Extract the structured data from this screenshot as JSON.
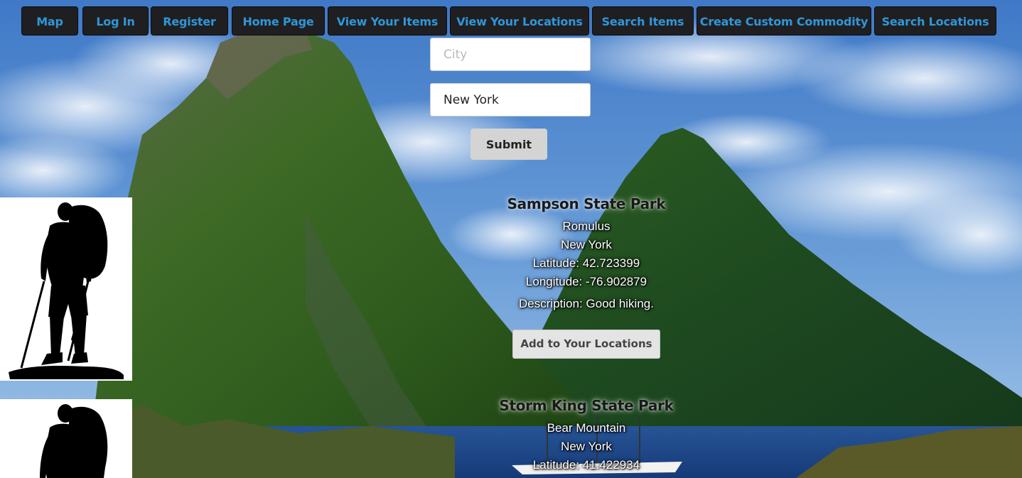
{
  "nav": {
    "items": [
      {
        "label": "Map"
      },
      {
        "label": "Log In"
      },
      {
        "label": "Register"
      },
      {
        "label": "Home Page"
      },
      {
        "label": "View Your Items"
      },
      {
        "label": "View Your Locations"
      },
      {
        "label": "Search Items"
      },
      {
        "label": "Create Custom Commodity"
      },
      {
        "label": "Search Locations"
      }
    ]
  },
  "search": {
    "city_placeholder": "City",
    "city_value": "",
    "state_value": "New York",
    "submit_label": "Submit"
  },
  "results": [
    {
      "name": "Sampson State Park",
      "city": "Romulus",
      "state": "New York",
      "latitude": "Latitude: 42.723399",
      "longitude": "Longitude: -76.902879",
      "description": "Description: Good hiking.",
      "add_label": "Add to Your Locations"
    },
    {
      "name": "Storm King State Park",
      "city": "Bear Mountain",
      "state": "New York",
      "latitude": "Latitude: 41.422934"
    }
  ],
  "images": {
    "hiker_icon": "hiker-silhouette-icon",
    "background": "mountain-lake-photo"
  },
  "colors": {
    "nav_bg": "#1f1f22",
    "nav_text": "#2f97d8",
    "submit_bg": "#d4d4d4",
    "add_bg": "#e4e4e4"
  }
}
